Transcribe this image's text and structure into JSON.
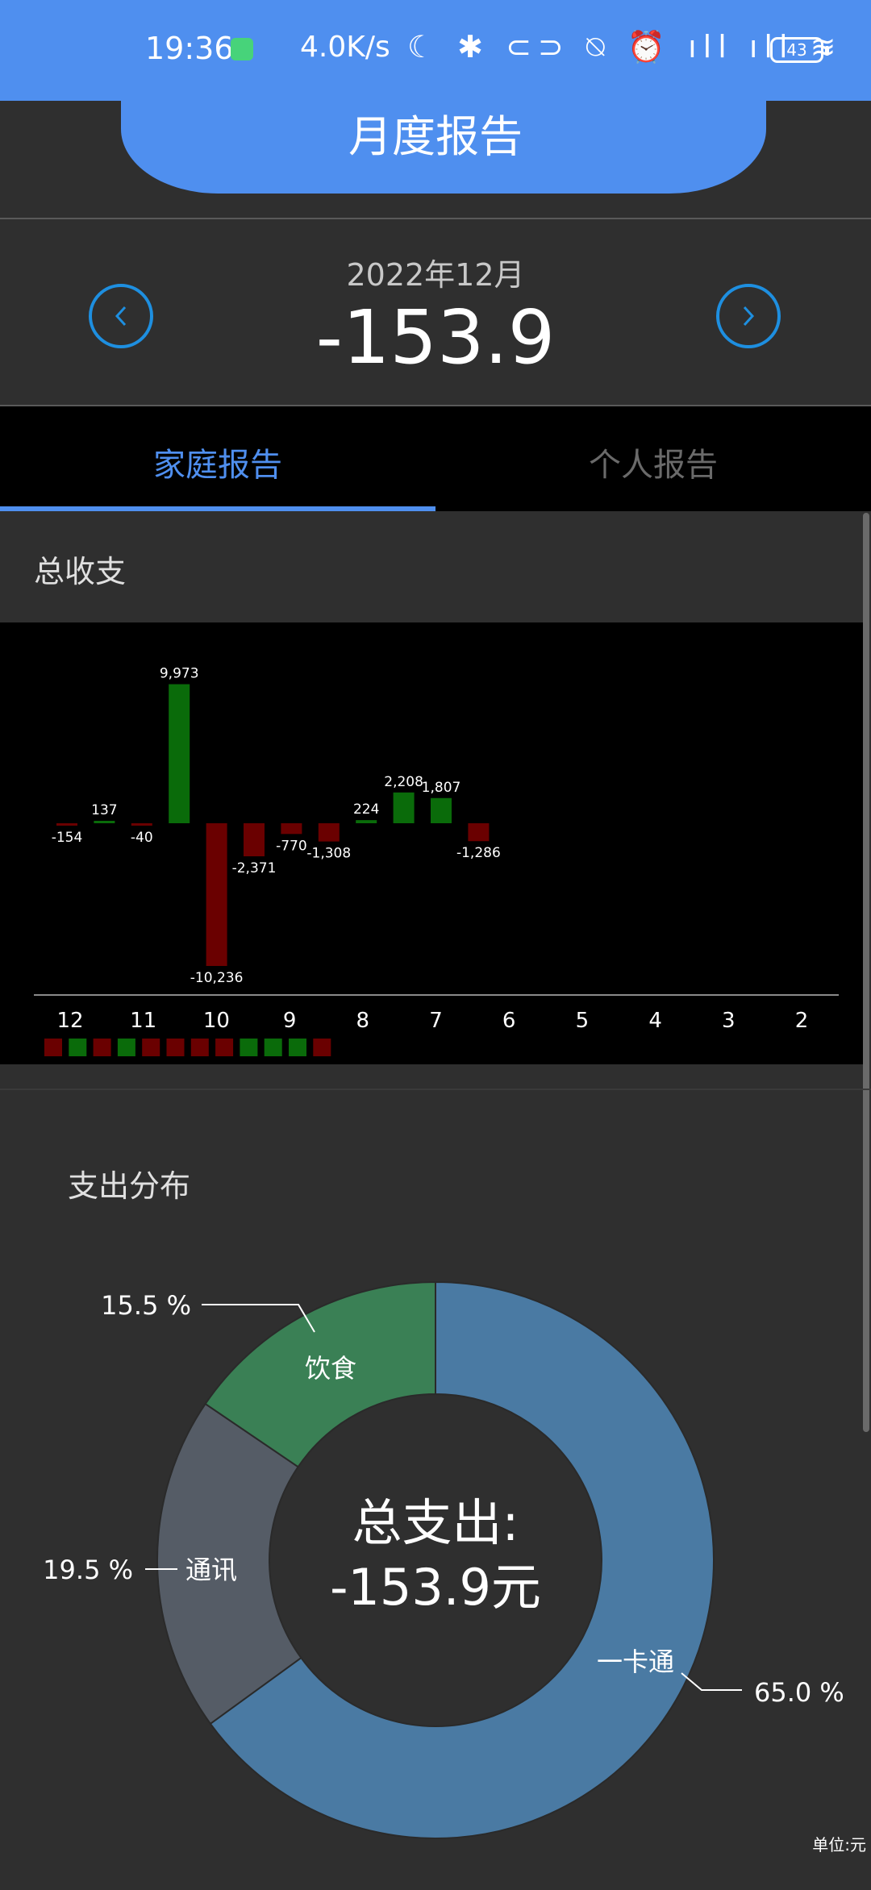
{
  "status_bar": {
    "time": "19:36",
    "speed": "4.0K/s",
    "icons": "☾ ✱ ⊂⊃ ⍉ ⏰ ıll ıll ≋",
    "battery": "43"
  },
  "header": {
    "title": "月度报告"
  },
  "month_nav": {
    "label": "2022年12月",
    "total": "-153.9",
    "prev_icon": "chevron-left-icon",
    "next_icon": "chevron-right-icon"
  },
  "tabs": [
    {
      "label": "家庭报告",
      "active": true
    },
    {
      "label": "个人报告",
      "active": false
    }
  ],
  "sections": {
    "income_expense_title": "总收支",
    "expense_distribution_title": "支出分布"
  },
  "colors": {
    "accent": "#4f8fef",
    "positive": "#0a6b0a",
    "negative": "#6a0000",
    "pie_blue": "#4a7aa3",
    "pie_gray": "#555c66",
    "pie_green": "#3a8055"
  },
  "chart_data": [
    {
      "type": "bar",
      "categories": [
        "12",
        "11",
        "10",
        "9",
        "8",
        "7",
        "6",
        "5",
        "4",
        "3",
        "2"
      ],
      "values": [
        -154,
        137,
        -40,
        9973,
        -10236,
        -2371,
        -770,
        -1308,
        224,
        2208,
        1807,
        -1286
      ],
      "value_labels": [
        "-154",
        "137",
        "-40",
        "9,973",
        "-10,236",
        "-2,371",
        "-770",
        "-1,308",
        "224",
        "2,208",
        "1,807",
        "-1,286"
      ],
      "legend_squares": [
        "neg",
        "pos",
        "neg",
        "pos",
        "neg",
        "neg",
        "neg",
        "neg",
        "pos",
        "pos",
        "pos",
        "neg"
      ],
      "ylim": [
        -10236,
        9973
      ]
    },
    {
      "type": "pie",
      "center_label": "总支出:",
      "center_value": "-153.9元",
      "slices": [
        {
          "name": "一卡通",
          "value": 65.0,
          "label": "65.0 %"
        },
        {
          "name": "通讯",
          "value": 19.5,
          "label": "19.5 %"
        },
        {
          "name": "饮食",
          "value": 15.5,
          "label": "15.5 %"
        }
      ]
    }
  ],
  "footer": {
    "unit": "单位:元"
  }
}
